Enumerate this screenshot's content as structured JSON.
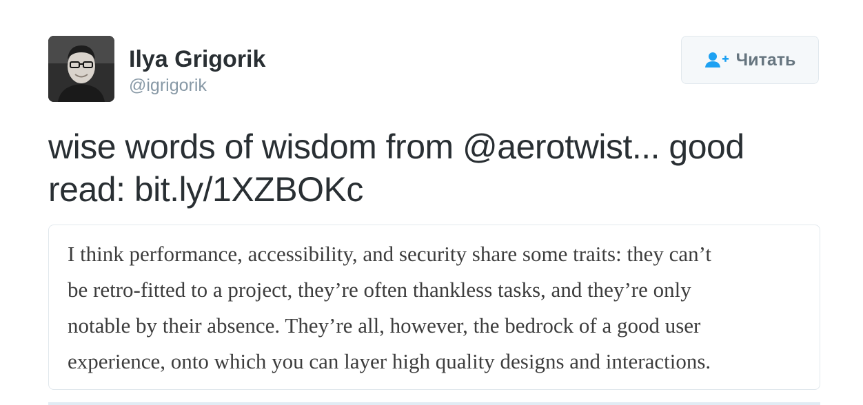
{
  "author": {
    "name": "Ilya Grigorik",
    "handle": "@igrigorik"
  },
  "follow_button": {
    "label": "Читать",
    "icon": "follow-user-plus-icon"
  },
  "tweet": {
    "lines": [
      "wise words of wisdom from @aerotwist... good",
      "read: bit.ly/1XZBOKc"
    ]
  },
  "quote": {
    "lines": [
      "I think performance, accessibility, and security share some traits: they can’t",
      "be retro-fitted to a project, they’re often thankless tasks, and they’re only",
      "notable by their absence. They’re all, however, the bedrock of a good user",
      "experience, onto which you can layer high quality designs and interactions."
    ]
  },
  "colors": {
    "accent": "#1da1f2",
    "text": "#292f33",
    "muted": "#8899a6",
    "border": "#e1e8ed"
  }
}
